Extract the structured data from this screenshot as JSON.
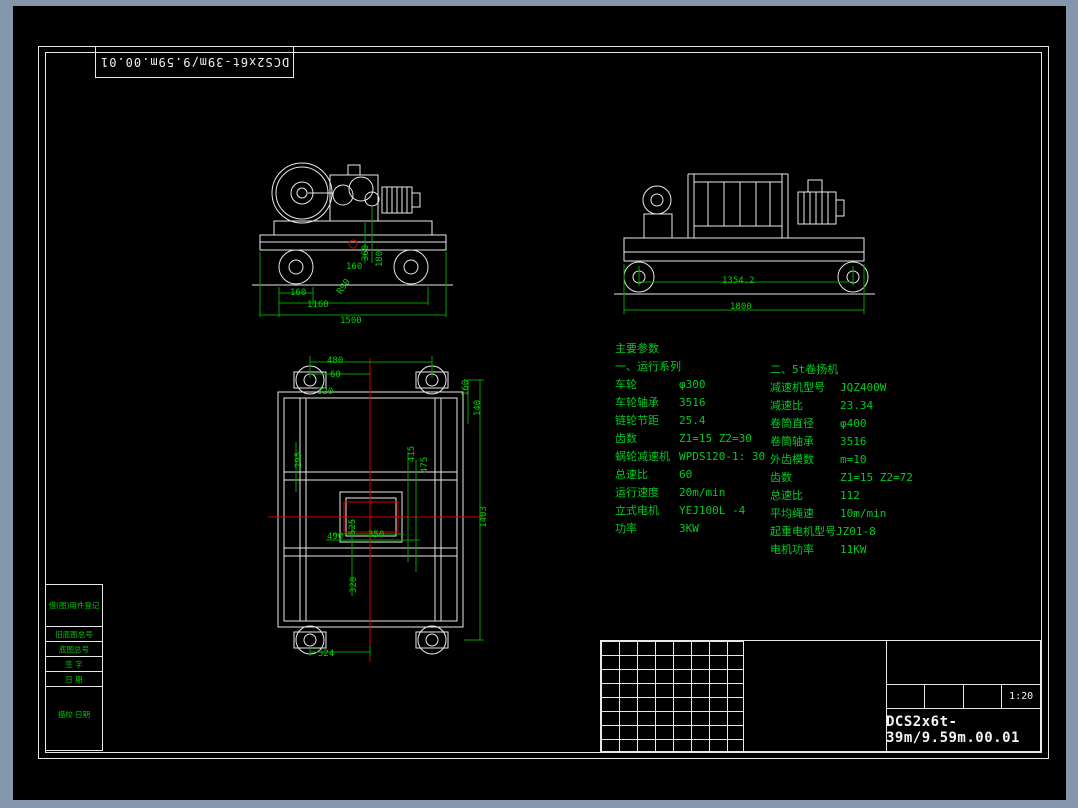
{
  "window": {
    "background": "#8496ab",
    "canvas": "#000000"
  },
  "colors": {
    "line": "#e8e8e8",
    "dimension": "#00d000",
    "text_green": "#00cc22",
    "centerline_red": "#d00000"
  },
  "titles": {
    "top_rotated": "DCS2x6t-39m/9.59m.00.01",
    "main": "DCS2x6t-39m/9.59m.00.01",
    "scale": "1:20"
  },
  "left_table": {
    "rows": [
      "借(图)用件登记",
      "旧底图总号",
      "底图总号",
      "签 字",
      "日 期",
      "描校 日期"
    ]
  },
  "params": {
    "title": "主要参数",
    "section1": {
      "title": "一、运行系列",
      "items": [
        {
          "label": "车轮",
          "value": "φ300"
        },
        {
          "label": "车轮轴承",
          "value": "3516"
        },
        {
          "label": "链轮节距",
          "value": "25.4"
        },
        {
          "label": "齿数",
          "value": "Z1=15  Z2=30"
        },
        {
          "label": "蜗轮减速机",
          "value": "WPDS120-1: 30"
        },
        {
          "label": "总速比",
          "value": "60"
        },
        {
          "label": "运行速度",
          "value": "20m/min"
        },
        {
          "label": "立式电机",
          "value": "YEJ100L -4"
        },
        {
          "label": "功率",
          "value": "3KW"
        }
      ]
    },
    "section2": {
      "title": "二、5t卷扬机",
      "items": [
        {
          "label": "减速机型号",
          "value": "JQZ400W"
        },
        {
          "label": "减速比",
          "value": "23.34"
        },
        {
          "label": "卷筒直径",
          "value": "φ400"
        },
        {
          "label": "卷筒轴承",
          "value": "3516"
        },
        {
          "label": "外齿模数",
          "value": "m=10"
        },
        {
          "label": "齿数",
          "value": "Z1=15  Z2=72"
        },
        {
          "label": "总速比",
          "value": "112"
        },
        {
          "label": "平均绳速",
          "value": "10m/min"
        },
        {
          "label": "起重电机型号JZ",
          "value": "01-8"
        },
        {
          "label": "电机功率",
          "value": "11KW"
        }
      ]
    }
  },
  "dims": {
    "side": {
      "width_overhang": "160",
      "width_wheelbase": "1160",
      "width_total": "1500",
      "radius": "R90",
      "height_a": "360",
      "height_b": "180",
      "height_c": "160"
    },
    "end": {
      "drum_span": "1354.2",
      "total_width": "1800"
    },
    "plan": {
      "top_width": "480",
      "top_offset": "60",
      "top_inner": "320",
      "right_a": "160",
      "right_b": "140",
      "right_total": "1403",
      "left_a": "295",
      "mid_a": "415",
      "mid_b": "475",
      "mid_c": "525",
      "mid_w1": "350",
      "mid_w2": "490",
      "bottom_a": "320",
      "bottom_width": "524"
    }
  }
}
